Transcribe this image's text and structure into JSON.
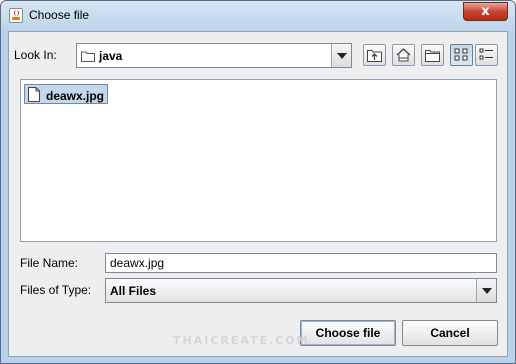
{
  "window": {
    "title": "Choose file",
    "close_glyph": "x"
  },
  "look_in": {
    "label": "Look In:",
    "value": "java",
    "icon": "folder-icon"
  },
  "toolbar": {
    "buttons": [
      {
        "name": "up-one-level-button",
        "icon": "folder-up-icon"
      },
      {
        "name": "home-button",
        "icon": "home-icon"
      },
      {
        "name": "new-folder-button",
        "icon": "new-folder-icon"
      },
      {
        "name": "list-view-button",
        "icon": "list-view-icon",
        "pressed": true
      },
      {
        "name": "details-view-button",
        "icon": "details-view-icon",
        "pressed": false
      }
    ]
  },
  "files": [
    {
      "name": "deawx.jpg",
      "selected": true,
      "icon": "file-icon"
    }
  ],
  "file_name": {
    "label": "File Name:",
    "value": "deawx.jpg"
  },
  "files_of_type": {
    "label": "Files of Type:",
    "value": "All Files"
  },
  "buttons": {
    "approve": "Choose file",
    "cancel": "Cancel"
  },
  "watermark": "THAICREATE.COM",
  "colors": {
    "selection": "#c3d6ea",
    "frame": "#b9d1ea",
    "close": "#c7432e"
  }
}
